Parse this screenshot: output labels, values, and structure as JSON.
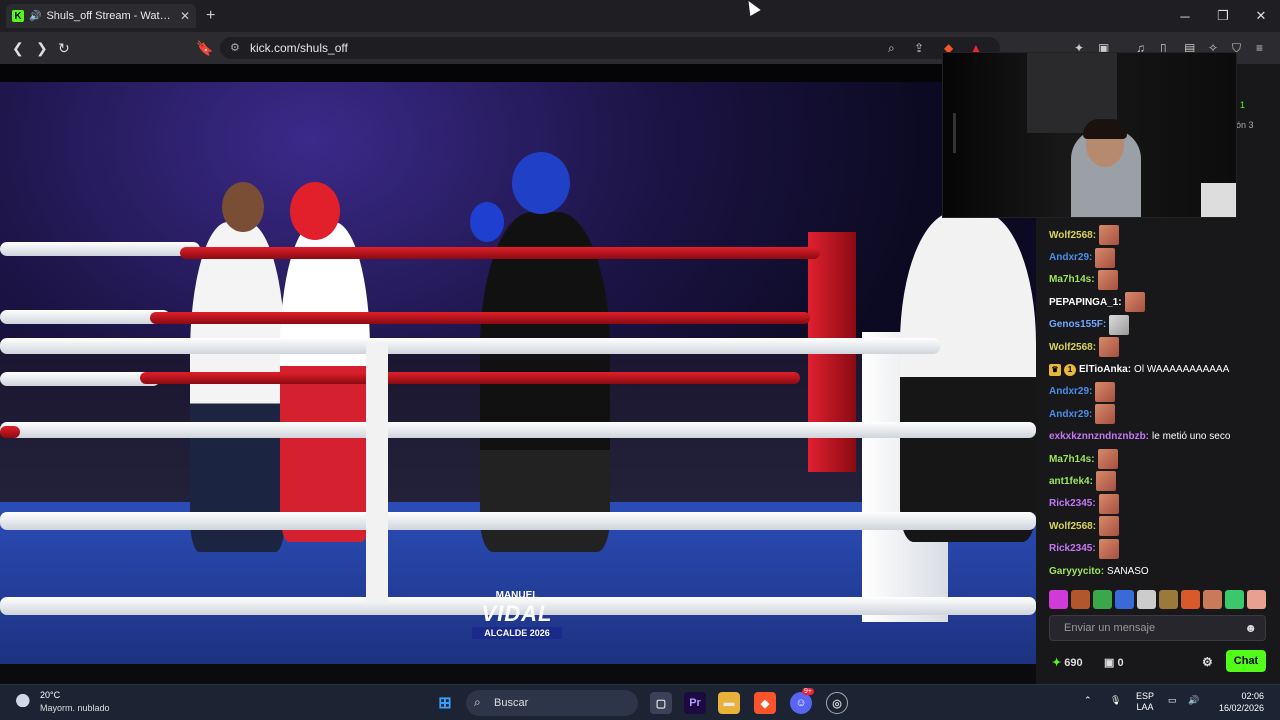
{
  "browser": {
    "tab_title": "Shuls_off Stream - Watch Live",
    "url": "kick.com/shuls_off",
    "tab_icon_letter": "K"
  },
  "sidebar_snippet": {
    "line1": "1",
    "line2": "ón 3"
  },
  "overlay": {
    "brand": "VIDAL",
    "top": "MANUEL",
    "bottom": "ALCALDE 2026"
  },
  "chat": {
    "messages": [
      {
        "user": "Wolf2568:",
        "color": "#d9d35a",
        "text": "",
        "emote": "face"
      },
      {
        "user": "Andxr29:",
        "color": "#4a8ee8",
        "text": "",
        "emote": "face"
      },
      {
        "user": "Ma7h14s:",
        "color": "#9fe65a",
        "text": "",
        "emote": "face"
      },
      {
        "user": "PEPAPINGA_1:",
        "color": "#ffffff",
        "text": "",
        "emote": "face"
      },
      {
        "user": "Genos155F:",
        "color": "#6fa8ff",
        "text": "",
        "emote": "cat"
      },
      {
        "user": "Wolf2568:",
        "color": "#d9d35a",
        "text": "",
        "emote": "face"
      },
      {
        "user": "ElTioAnka:",
        "color": "#ffffff",
        "text": "Ol WAAAAAAAAAAA",
        "emote": "",
        "badges": true
      },
      {
        "user": "Andxr29:",
        "color": "#4a8ee8",
        "text": "",
        "emote": "face"
      },
      {
        "user": "Andxr29:",
        "color": "#4a8ee8",
        "text": "",
        "emote": "face"
      },
      {
        "user": "exkxkznnzndnznbzb:",
        "color": "#c478f0",
        "text": "le metió uno seco",
        "emote": ""
      },
      {
        "user": "Ma7h14s:",
        "color": "#9fe65a",
        "text": "",
        "emote": "face"
      },
      {
        "user": "ant1fek4:",
        "color": "#9fe65a",
        "text": "",
        "emote": "face"
      },
      {
        "user": "Rick2345:",
        "color": "#c478f0",
        "text": "",
        "emote": "face"
      },
      {
        "user": "Wolf2568:",
        "color": "#d9d35a",
        "text": "",
        "emote": "face"
      },
      {
        "user": "Rick2345:",
        "color": "#c478f0",
        "text": "",
        "emote": "face"
      },
      {
        "user": "Garyyycito:",
        "color": "#9fe65a",
        "text": "SANASO",
        "emote": ""
      }
    ],
    "input_placeholder": "Enviar un mensaje",
    "points": "690",
    "subs": "0",
    "send_label": "Chat",
    "accent": "#53fc18"
  },
  "taskbar": {
    "temp": "20°C",
    "weather": "Mayorm. nublado",
    "search": "Buscar",
    "lang1": "ESP",
    "lang2": "LAA",
    "time": "02:06",
    "date": "16/02/2026",
    "discord_badge": "9+"
  }
}
